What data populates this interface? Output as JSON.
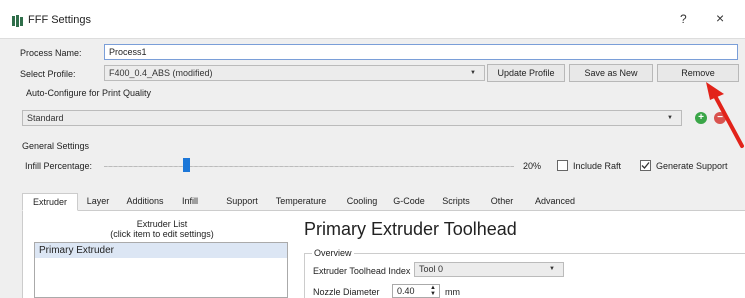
{
  "window": {
    "title": "FFF Settings",
    "help_label": "?",
    "close_label": "×"
  },
  "process": {
    "label": "Process Name:",
    "value": "Process1"
  },
  "profile": {
    "label": "Select Profile:",
    "value": "F400_0.4_ABS (modified)",
    "update_label": "Update Profile",
    "save_as_new_label": "Save as New",
    "remove_label": "Remove"
  },
  "autoconfig": {
    "label": "Auto-Configure for Print Quality",
    "value": "Standard",
    "add_label": "+",
    "remove_label": "−"
  },
  "general": {
    "label": "General Settings",
    "infill_label": "Infill Percentage:",
    "infill_value": "20%",
    "infill_fraction": 0.2,
    "include_raft_label": "Include Raft",
    "include_raft_checked": false,
    "generate_support_label": "Generate Support",
    "generate_support_checked": true
  },
  "tabs": [
    "Extruder",
    "Layer",
    "Additions",
    "Infill",
    "Support",
    "Temperature",
    "Cooling",
    "G-Code",
    "Scripts",
    "Other",
    "Advanced"
  ],
  "active_tab": "Extruder",
  "extruder": {
    "list_header_line1": "Extruder List",
    "list_header_line2": "(click item to edit settings)",
    "items": [
      "Primary Extruder"
    ],
    "toolhead_title": "Primary Extruder Toolhead",
    "overview_label": "Overview",
    "index_label": "Extruder Toolhead Index",
    "index_value": "Tool 0",
    "nozzle_label": "Nozzle Diameter",
    "nozzle_value": "0.40",
    "nozzle_unit": "mm"
  },
  "colors": {
    "accent_blue": "#1c77d8",
    "add_green": "#3aa648",
    "remove_red": "#d9534f",
    "annotation_arrow": "#e2231a"
  },
  "icons": {
    "window_icon": "settings-app-icon",
    "annotation": "red-arrow-icon"
  }
}
